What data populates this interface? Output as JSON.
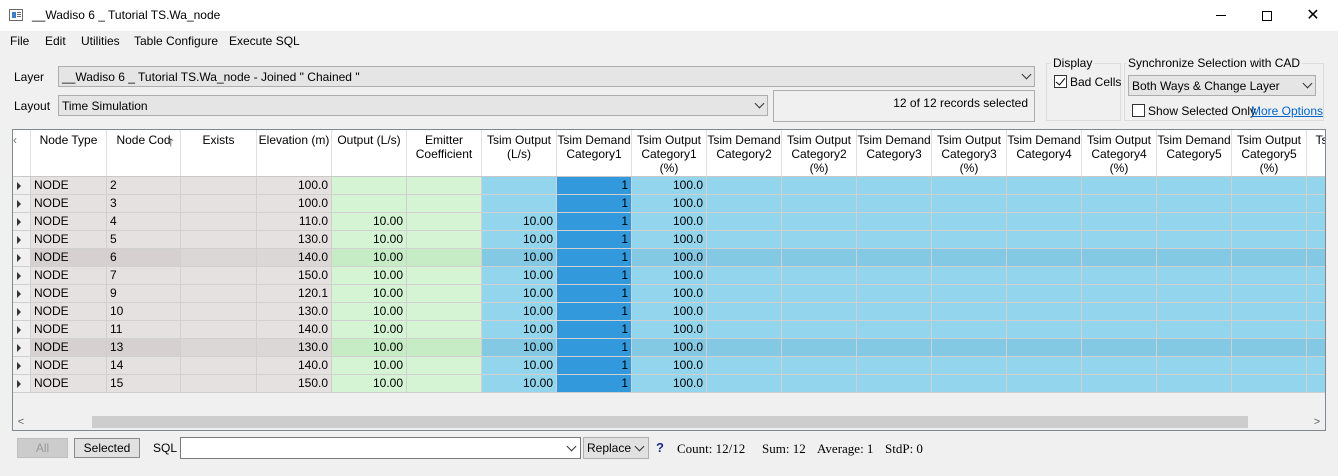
{
  "window": {
    "title": "__Wadiso 6 _ Tutorial TS.Wa_node"
  },
  "menu": [
    "File",
    "Edit",
    "Utilities",
    "Table Configure",
    "Execute SQL"
  ],
  "layer": {
    "label": "Layer",
    "value": "__Wadiso 6 _ Tutorial TS.Wa_node - Joined \" Chained \""
  },
  "layout": {
    "label": "Layout",
    "value": "Time Simulation"
  },
  "records_status": "12 of 12 records selected",
  "display": {
    "title": "Display",
    "bad_cells_label": "Bad Cells",
    "bad_cells_checked": true
  },
  "sync": {
    "title": "Synchronize Selection with CAD",
    "value": "Both Ways & Change Layer",
    "show_selected_label": "Show Selected Only",
    "show_selected_checked": false,
    "more_options": "More Options"
  },
  "columns": [
    "Node Type",
    "Node Cod",
    "Exists",
    "Elevation (m)",
    "Output (L/s)",
    "Emitter Coefficient",
    "Tsim Output (L/s)",
    "Tsim Demand Category1",
    "Tsim Output Category1 (%)",
    "Tsim Demand Category2",
    "Tsim Output Category2 (%)",
    "Tsim Demand Category3",
    "Tsim Output Category3 (%)",
    "Tsim Demand Category4",
    "Tsim Output Category4 (%)",
    "Tsim Demand Category5",
    "Tsim Output Category5 (%)",
    "Ts"
  ],
  "rows": [
    [
      "NODE",
      "2",
      "",
      "100.0",
      "",
      "",
      "",
      "1",
      "100.0"
    ],
    [
      "NODE",
      "3",
      "",
      "100.0",
      "",
      "",
      "",
      "1",
      "100.0"
    ],
    [
      "NODE",
      "4",
      "",
      "110.0",
      "10.00",
      "",
      "10.00",
      "1",
      "100.0"
    ],
    [
      "NODE",
      "5",
      "",
      "130.0",
      "10.00",
      "",
      "10.00",
      "1",
      "100.0"
    ],
    [
      "NODE",
      "6",
      "",
      "140.0",
      "10.00",
      "",
      "10.00",
      "1",
      "100.0"
    ],
    [
      "NODE",
      "7",
      "",
      "150.0",
      "10.00",
      "",
      "10.00",
      "1",
      "100.0"
    ],
    [
      "NODE",
      "9",
      "",
      "120.1",
      "10.00",
      "",
      "10.00",
      "1",
      "100.0"
    ],
    [
      "NODE",
      "10",
      "",
      "130.0",
      "10.00",
      "",
      "10.00",
      "1",
      "100.0"
    ],
    [
      "NODE",
      "11",
      "",
      "140.0",
      "10.00",
      "",
      "10.00",
      "1",
      "100.0"
    ],
    [
      "NODE",
      "13",
      "",
      "130.0",
      "10.00",
      "",
      "10.00",
      "1",
      "100.0"
    ],
    [
      "NODE",
      "14",
      "",
      "140.0",
      "10.00",
      "",
      "10.00",
      "1",
      "100.0"
    ],
    [
      "NODE",
      "15",
      "",
      "150.0",
      "10.00",
      "",
      "10.00",
      "1",
      "100.0"
    ]
  ],
  "colors": {
    "gray": "#e6e1e1",
    "gray_alt": "#dcd7d7",
    "green": "#d4f4d4",
    "green_alt": "#c6ecc6",
    "blue": "#92d5ed",
    "blue_alt": "#84c9e3",
    "blue_dark": "#3399dd"
  },
  "bottom": {
    "all_label": "All",
    "selected_label": "Selected",
    "sql_label": "SQL",
    "sql_value": "",
    "replace_value": "Replace",
    "help": "?",
    "count": "Count:  12/12",
    "sum": "Sum:  12",
    "average": "Average:  1",
    "stdp": "StdP:  0"
  }
}
